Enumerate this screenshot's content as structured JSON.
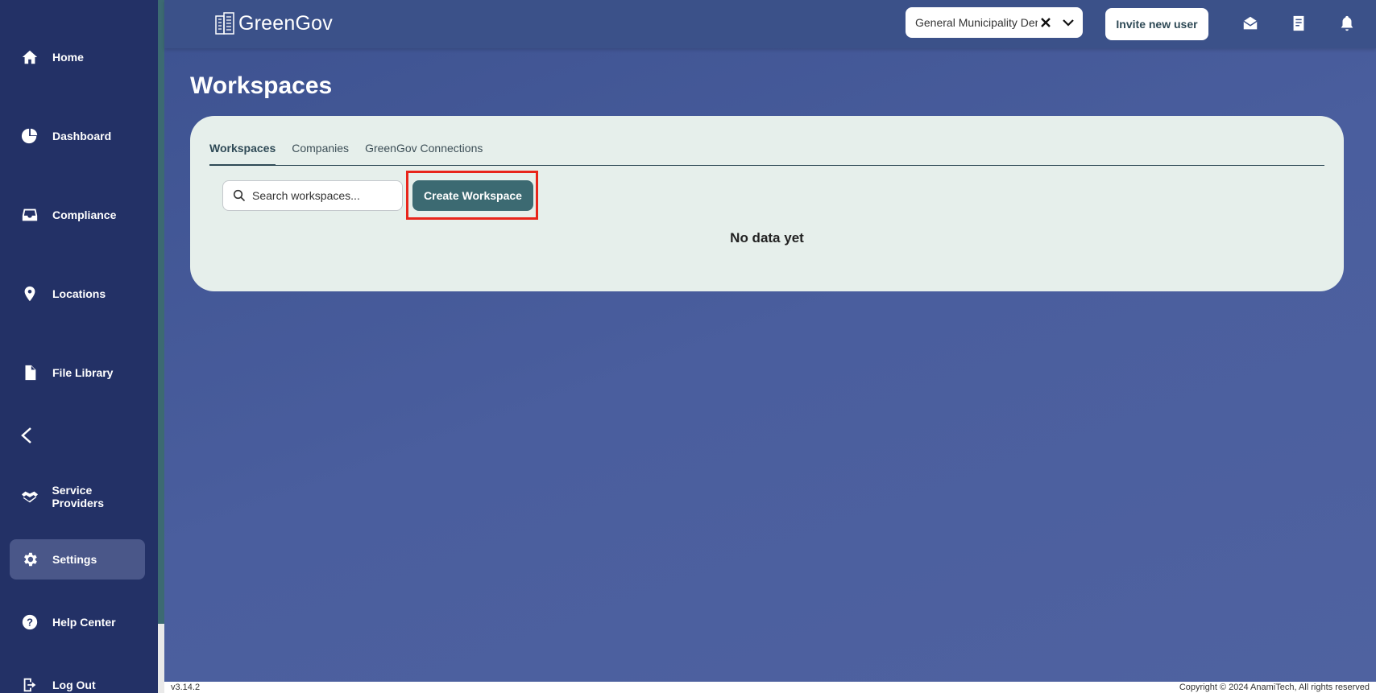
{
  "sidebar": {
    "items": [
      {
        "label": "Home",
        "icon": "home-icon"
      },
      {
        "label": "Dashboard",
        "icon": "pie-chart-icon"
      },
      {
        "label": "Compliance",
        "icon": "inbox-icon"
      },
      {
        "label": "Locations",
        "icon": "location-pin-icon"
      },
      {
        "label": "File Library",
        "icon": "file-icon"
      },
      {
        "label": "Service Providers",
        "icon": "handshake-icon"
      },
      {
        "label": "Settings",
        "icon": "gear-icon"
      },
      {
        "label": "Help Center",
        "icon": "help-circle-icon"
      },
      {
        "label": "Log Out",
        "icon": "logout-icon"
      }
    ],
    "active": "Settings"
  },
  "header": {
    "logo_text": "GreenGov",
    "org_select_value": "General Municipality Demo",
    "invite_label": "Invite new user"
  },
  "page": {
    "title": "Workspaces",
    "tabs": [
      {
        "label": "Workspaces",
        "active": true
      },
      {
        "label": "Companies",
        "active": false
      },
      {
        "label": "GreenGov Connections",
        "active": false
      }
    ],
    "search_placeholder": "Search workspaces...",
    "create_label": "Create Workspace",
    "empty_text": "No data yet"
  },
  "footer": {
    "version": "v3.14.2",
    "copyright": "Copyright © 2024 AnamiTech, All rights reserved"
  },
  "colors": {
    "sidebar_bg": "#233166",
    "main_bg": "#4a5e9e",
    "accent": "#3c6a72",
    "card_bg": "#e6efeb",
    "highlight": "#e8251b"
  }
}
